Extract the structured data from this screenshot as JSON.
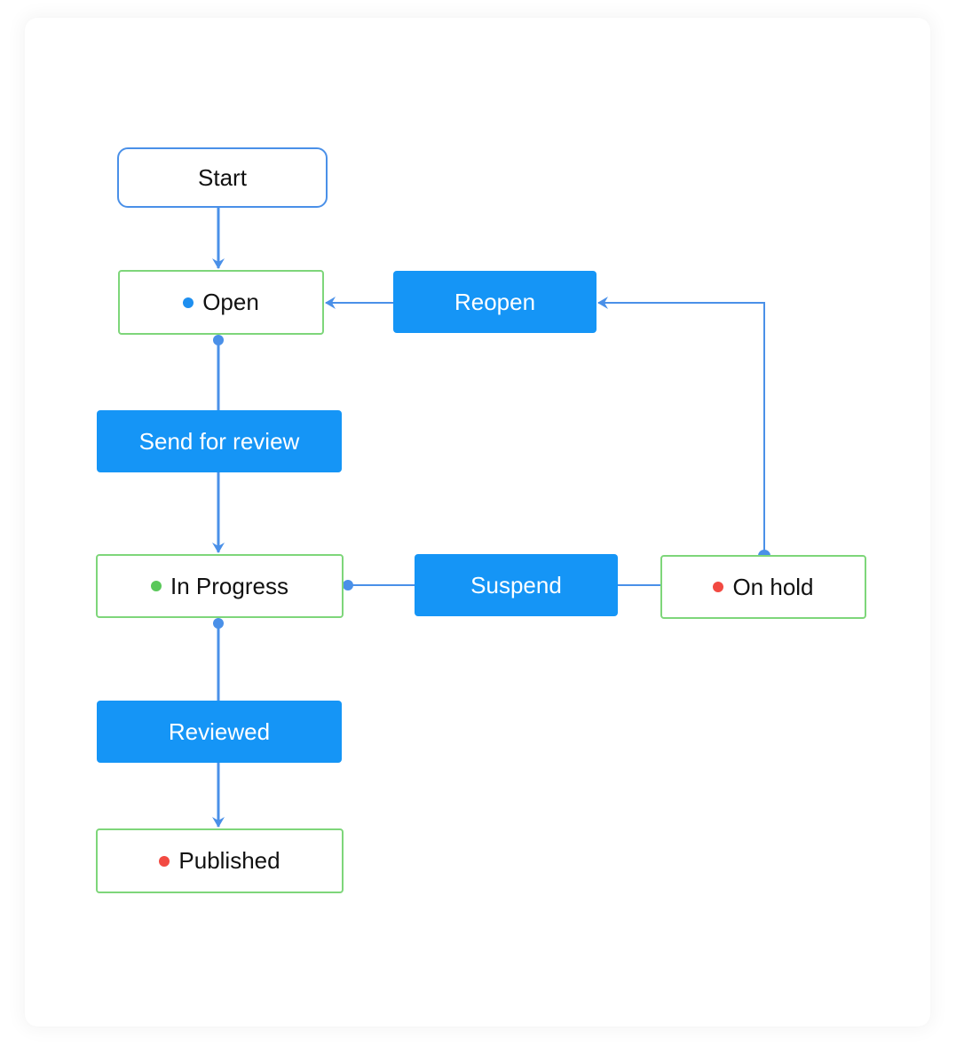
{
  "colors": {
    "connector": "#4a90e8",
    "action_bg": "#1595f6",
    "state_border": "#7ed67a",
    "start_border": "#4a90e8"
  },
  "states": {
    "start": {
      "label": "Start"
    },
    "open": {
      "label": "Open",
      "status_color": "#1e8ff0"
    },
    "in_progress": {
      "label": "In Progress",
      "status_color": "#5ac85a"
    },
    "on_hold": {
      "label": "On hold",
      "status_color": "#f24a42"
    },
    "published": {
      "label": "Published",
      "status_color": "#f24a42"
    }
  },
  "actions": {
    "send_for_review": {
      "label": "Send for review"
    },
    "reopen": {
      "label": "Reopen"
    },
    "suspend": {
      "label": "Suspend"
    },
    "reviewed": {
      "label": "Reviewed"
    }
  },
  "transitions": [
    {
      "from": "Start",
      "to": "Open"
    },
    {
      "from": "Open",
      "to": "In Progress",
      "action": "Send for review"
    },
    {
      "from": "In Progress",
      "to": "On hold",
      "action": "Suspend"
    },
    {
      "from": "On hold",
      "to": "Open",
      "action": "Reopen"
    },
    {
      "from": "In Progress",
      "to": "Published",
      "action": "Reviewed"
    }
  ]
}
